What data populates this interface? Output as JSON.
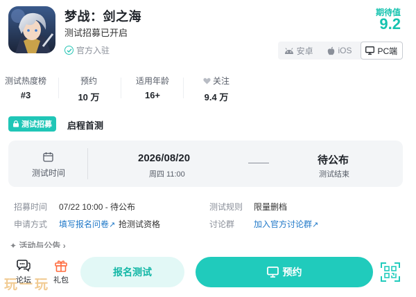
{
  "header": {
    "title": "梦战：剑之海",
    "subtitle": "测试招募已开启",
    "official": "官方入驻",
    "score_label": "期待值",
    "score_value": "9.2"
  },
  "platforms": [
    {
      "label": "安卓",
      "icon": "android-icon",
      "active": false
    },
    {
      "label": "iOS",
      "icon": "apple-icon",
      "active": false
    },
    {
      "label": "PC端",
      "icon": "monitor-icon",
      "active": true
    }
  ],
  "stats": [
    {
      "label": "测试热度榜",
      "value": "#3"
    },
    {
      "label": "预约",
      "value": "10 万"
    },
    {
      "label": "适用年龄",
      "value": "16+"
    },
    {
      "label": "关注",
      "value": "9.4 万",
      "icon": "heart-icon"
    }
  ],
  "recruit": {
    "badge": "测试招募",
    "title": "启程首测"
  },
  "test_time": {
    "label": "测试时间",
    "start_date": "2026/08/20",
    "start_sub": "周四 11:00",
    "end_value": "待公布",
    "end_sub": "测试结束"
  },
  "info": {
    "recruit_time_key": "招募时间",
    "recruit_time_val": "07/22 10:00 - 待公布",
    "rule_key": "测试规则",
    "rule_val": "限量删档",
    "method_key": "申请方式",
    "method_link": "填写报名问卷",
    "method_suffix": "抢测试资格",
    "group_key": "讨论群",
    "group_link": "加入官方讨论群"
  },
  "activity": "✦ 活动与公告 ›",
  "bottom": {
    "forum": "论坛",
    "gift": "礼包",
    "signup": "报名测试",
    "reserve": "预约",
    "watermark": "玩一玩"
  },
  "colors": {
    "accent": "#20cbbc",
    "link": "#1f78c8",
    "gift": "#ff6a3d"
  }
}
